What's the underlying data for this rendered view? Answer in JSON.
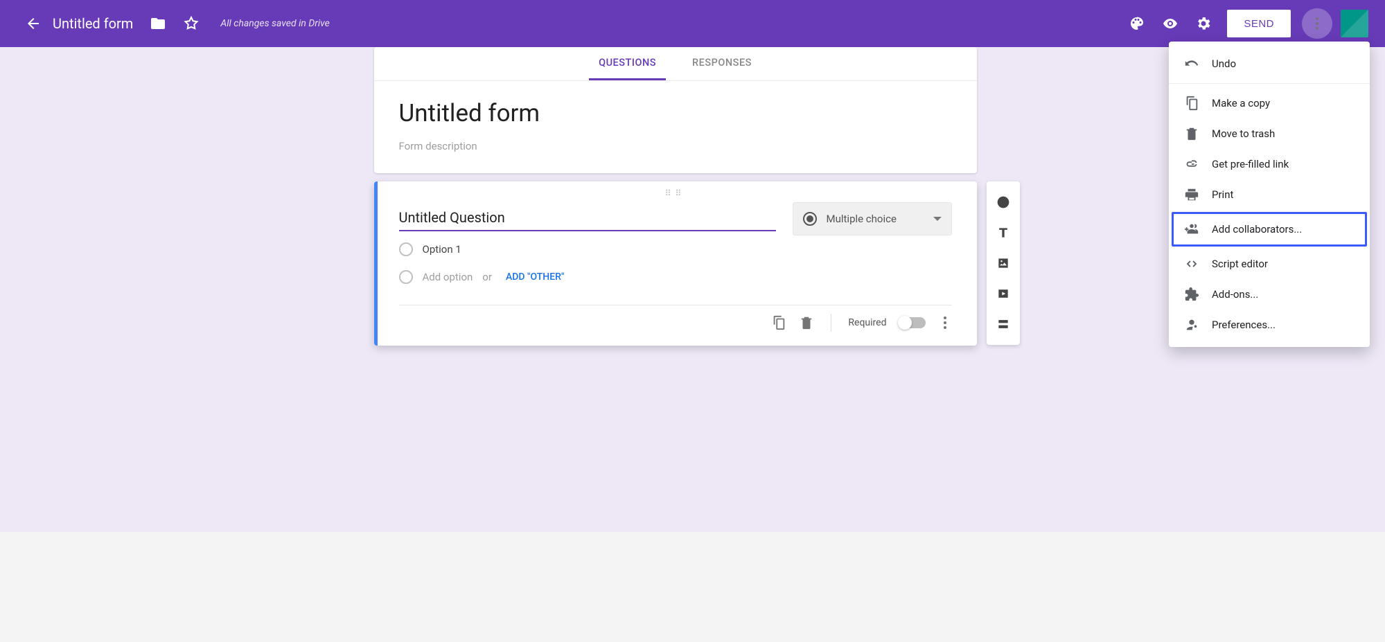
{
  "header": {
    "title": "Untitled form",
    "saved_status": "All changes saved in Drive",
    "send_label": "SEND"
  },
  "tabs": {
    "questions": "QUESTIONS",
    "responses": "RESPONSES"
  },
  "form": {
    "title": "Untitled form",
    "description_placeholder": "Form description"
  },
  "question": {
    "title": "Untitled Question",
    "type_label": "Multiple choice",
    "option1": "Option 1",
    "add_option": "Add option",
    "or": "or",
    "add_other": "ADD \"OTHER\"",
    "required_label": "Required"
  },
  "menu": {
    "undo": "Undo",
    "make_copy": "Make a copy",
    "move_to_trash": "Move to trash",
    "prefilled": "Get pre-filled link",
    "print": "Print",
    "add_collaborators": "Add collaborators...",
    "script_editor": "Script editor",
    "addons": "Add-ons...",
    "preferences": "Preferences..."
  }
}
